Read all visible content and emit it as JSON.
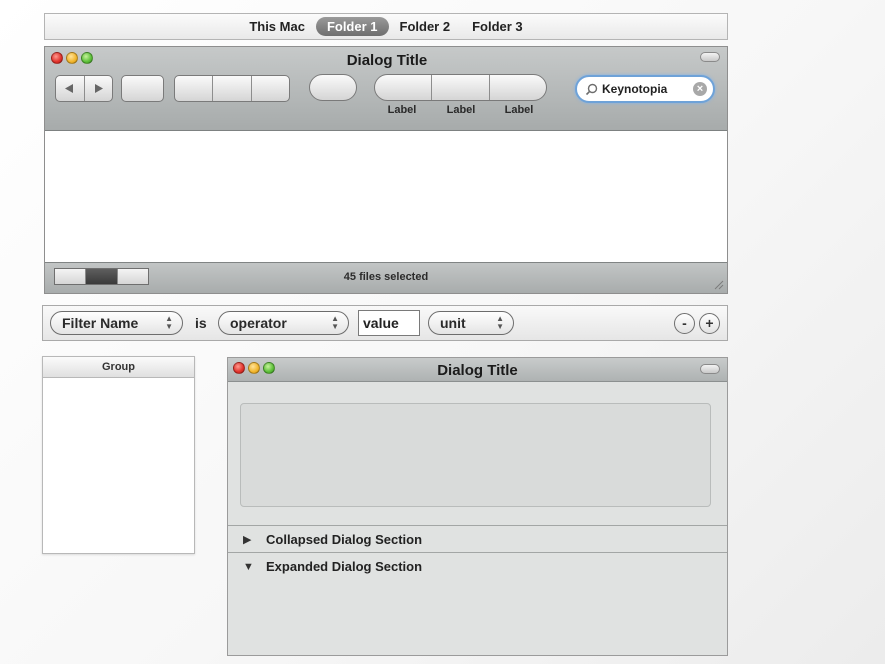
{
  "pathbar": {
    "items": [
      {
        "label": "This Mac",
        "active": false
      },
      {
        "label": "Folder 1",
        "active": true
      },
      {
        "label": "Folder 2",
        "active": false
      },
      {
        "label": "Folder 3",
        "active": false
      }
    ]
  },
  "window1": {
    "title": "Dialog Title",
    "toolbar": {
      "back_icon": "triangle-left",
      "forward_icon": "triangle-right",
      "segment_labels": [
        "Label",
        "Label",
        "Label"
      ]
    },
    "search": {
      "value": "Keynotopia",
      "icon": "search-icon",
      "clear_icon": "close-icon"
    },
    "footer": {
      "status": "45 files selected"
    }
  },
  "filter_row": {
    "name_popup": "Filter Name",
    "conjunction": "is",
    "operator_popup": "operator",
    "value": "value",
    "unit_popup": "unit",
    "remove_label": "-",
    "add_label": "+"
  },
  "group_list": {
    "header": "Group"
  },
  "window2": {
    "title": "Dialog Title",
    "sections": [
      {
        "label": "Collapsed Dialog Section",
        "expanded": false
      },
      {
        "label": "Expanded Dialog Section",
        "expanded": true
      }
    ]
  },
  "colors": {
    "accent_focus": "#6ea2d8",
    "toolbar_gray": "#a7abab",
    "close_red": "#e0312a",
    "minimize_yellow": "#f1b52b",
    "zoom_green": "#5bbf38"
  }
}
